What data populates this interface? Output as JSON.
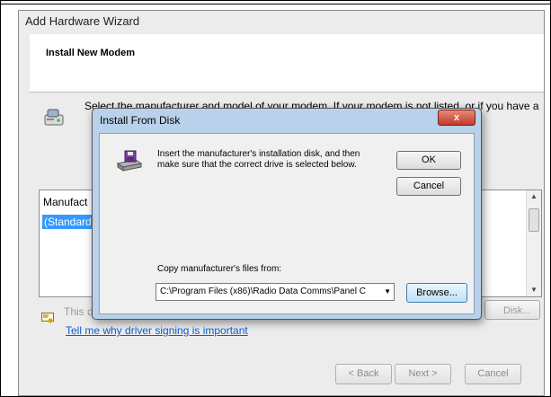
{
  "wizard": {
    "title": "Add Hardware Wizard",
    "heading": "Install New Modem",
    "description": "Select the manufacturer and model of your modem. If your modem is not listed, or if you have a",
    "list_header": "Manufact",
    "list_selected": "(Standard",
    "signed_text": "This d",
    "have_disk_label": "Disk...",
    "link_text": "Tell me why driver signing is important",
    "back_label": "< Back",
    "next_label": "Next >",
    "cancel_label": "Cancel"
  },
  "dialog": {
    "title": "Install From Disk",
    "close_label": "x",
    "instruction": "Insert the manufacturer's installation disk, and then make sure that the correct drive is selected below.",
    "ok_label": "OK",
    "cancel_label": "Cancel",
    "copy_label": "Copy manufacturer's files from:",
    "path_value": "C:\\Program Files (x86)\\Radio Data Comms\\Panel C",
    "browse_label": "Browse..."
  },
  "colors": {
    "selection": "#3399ff",
    "link": "#0b5bd8",
    "dialog_frame": "#b9d1ea",
    "close_button": "#c2392a"
  },
  "icons": [
    "modem-icon",
    "certificate-icon",
    "disk-drive-icon",
    "close-icon",
    "dropdown-arrow-icon",
    "scroll-up-icon",
    "scroll-down-icon"
  ]
}
